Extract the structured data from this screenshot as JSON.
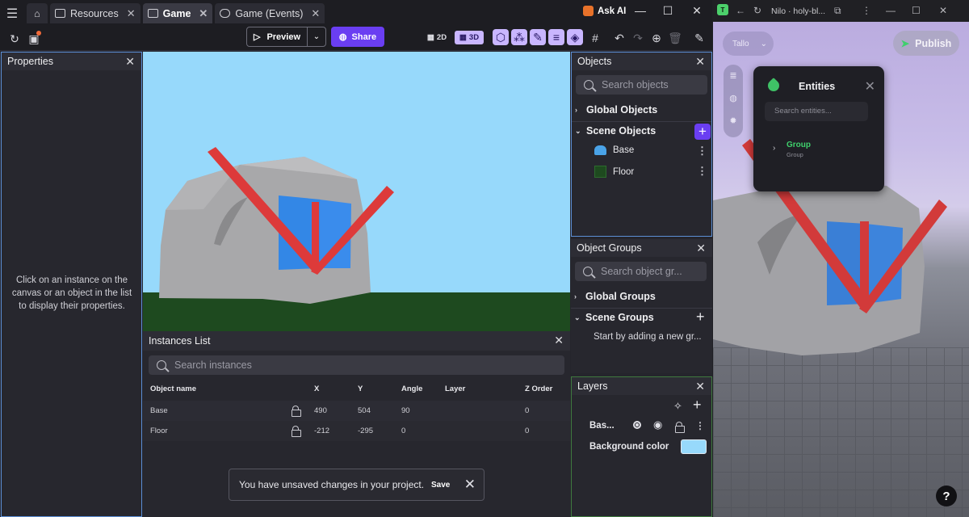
{
  "titlebar": {
    "tabs": [
      {
        "label": "Resources"
      },
      {
        "label": "Game"
      },
      {
        "label": "Game (Events)"
      }
    ],
    "ask_ai": "Ask AI"
  },
  "toolbar": {
    "preview": "Preview",
    "share": "Share",
    "mode_2d": "2D",
    "mode_3d": "3D"
  },
  "properties": {
    "title": "Properties",
    "empty_text": "Click on an instance on the canvas or an object in the list to display their properties."
  },
  "instances": {
    "title": "Instances List",
    "search_placeholder": "Search instances",
    "columns": [
      "Object name",
      "X",
      "Y",
      "Angle",
      "Layer",
      "Z Order"
    ],
    "rows": [
      {
        "name": "Base",
        "x": "490",
        "y": "504",
        "angle": "90",
        "layer": "",
        "z": "0"
      },
      {
        "name": "Floor",
        "x": "-212",
        "y": "-295",
        "angle": "0",
        "layer": "",
        "z": "0"
      }
    ]
  },
  "toast": {
    "message": "You have unsaved changes in your project.",
    "save": "Save"
  },
  "objects": {
    "title": "Objects",
    "search_placeholder": "Search objects",
    "global": "Global Objects",
    "scene": "Scene Objects",
    "items": [
      {
        "name": "Base"
      },
      {
        "name": "Floor"
      }
    ]
  },
  "groups": {
    "title": "Object Groups",
    "search_placeholder": "Search object gr...",
    "global": "Global Groups",
    "scene": "Scene Groups",
    "hint": "Start by adding a new gr..."
  },
  "layers": {
    "title": "Layers",
    "base_layer": "Bas...",
    "background_color_label": "Background color",
    "background_color": "#97d9fb"
  },
  "nilo": {
    "tab_title": "Nilo · holy-bl...",
    "project_chip": "Tallo",
    "publish": "Publish",
    "entities_title": "Entities",
    "entities_search": "Search entities...",
    "entity_name": "Group",
    "entity_type": "Group",
    "help": "?"
  },
  "colors": {
    "accent": "#6a3ef2",
    "selection_border": "#5c8fd6",
    "sky": "#97d9fb",
    "ground": "#1e4a1f",
    "nilo_green": "#3fd06c"
  }
}
